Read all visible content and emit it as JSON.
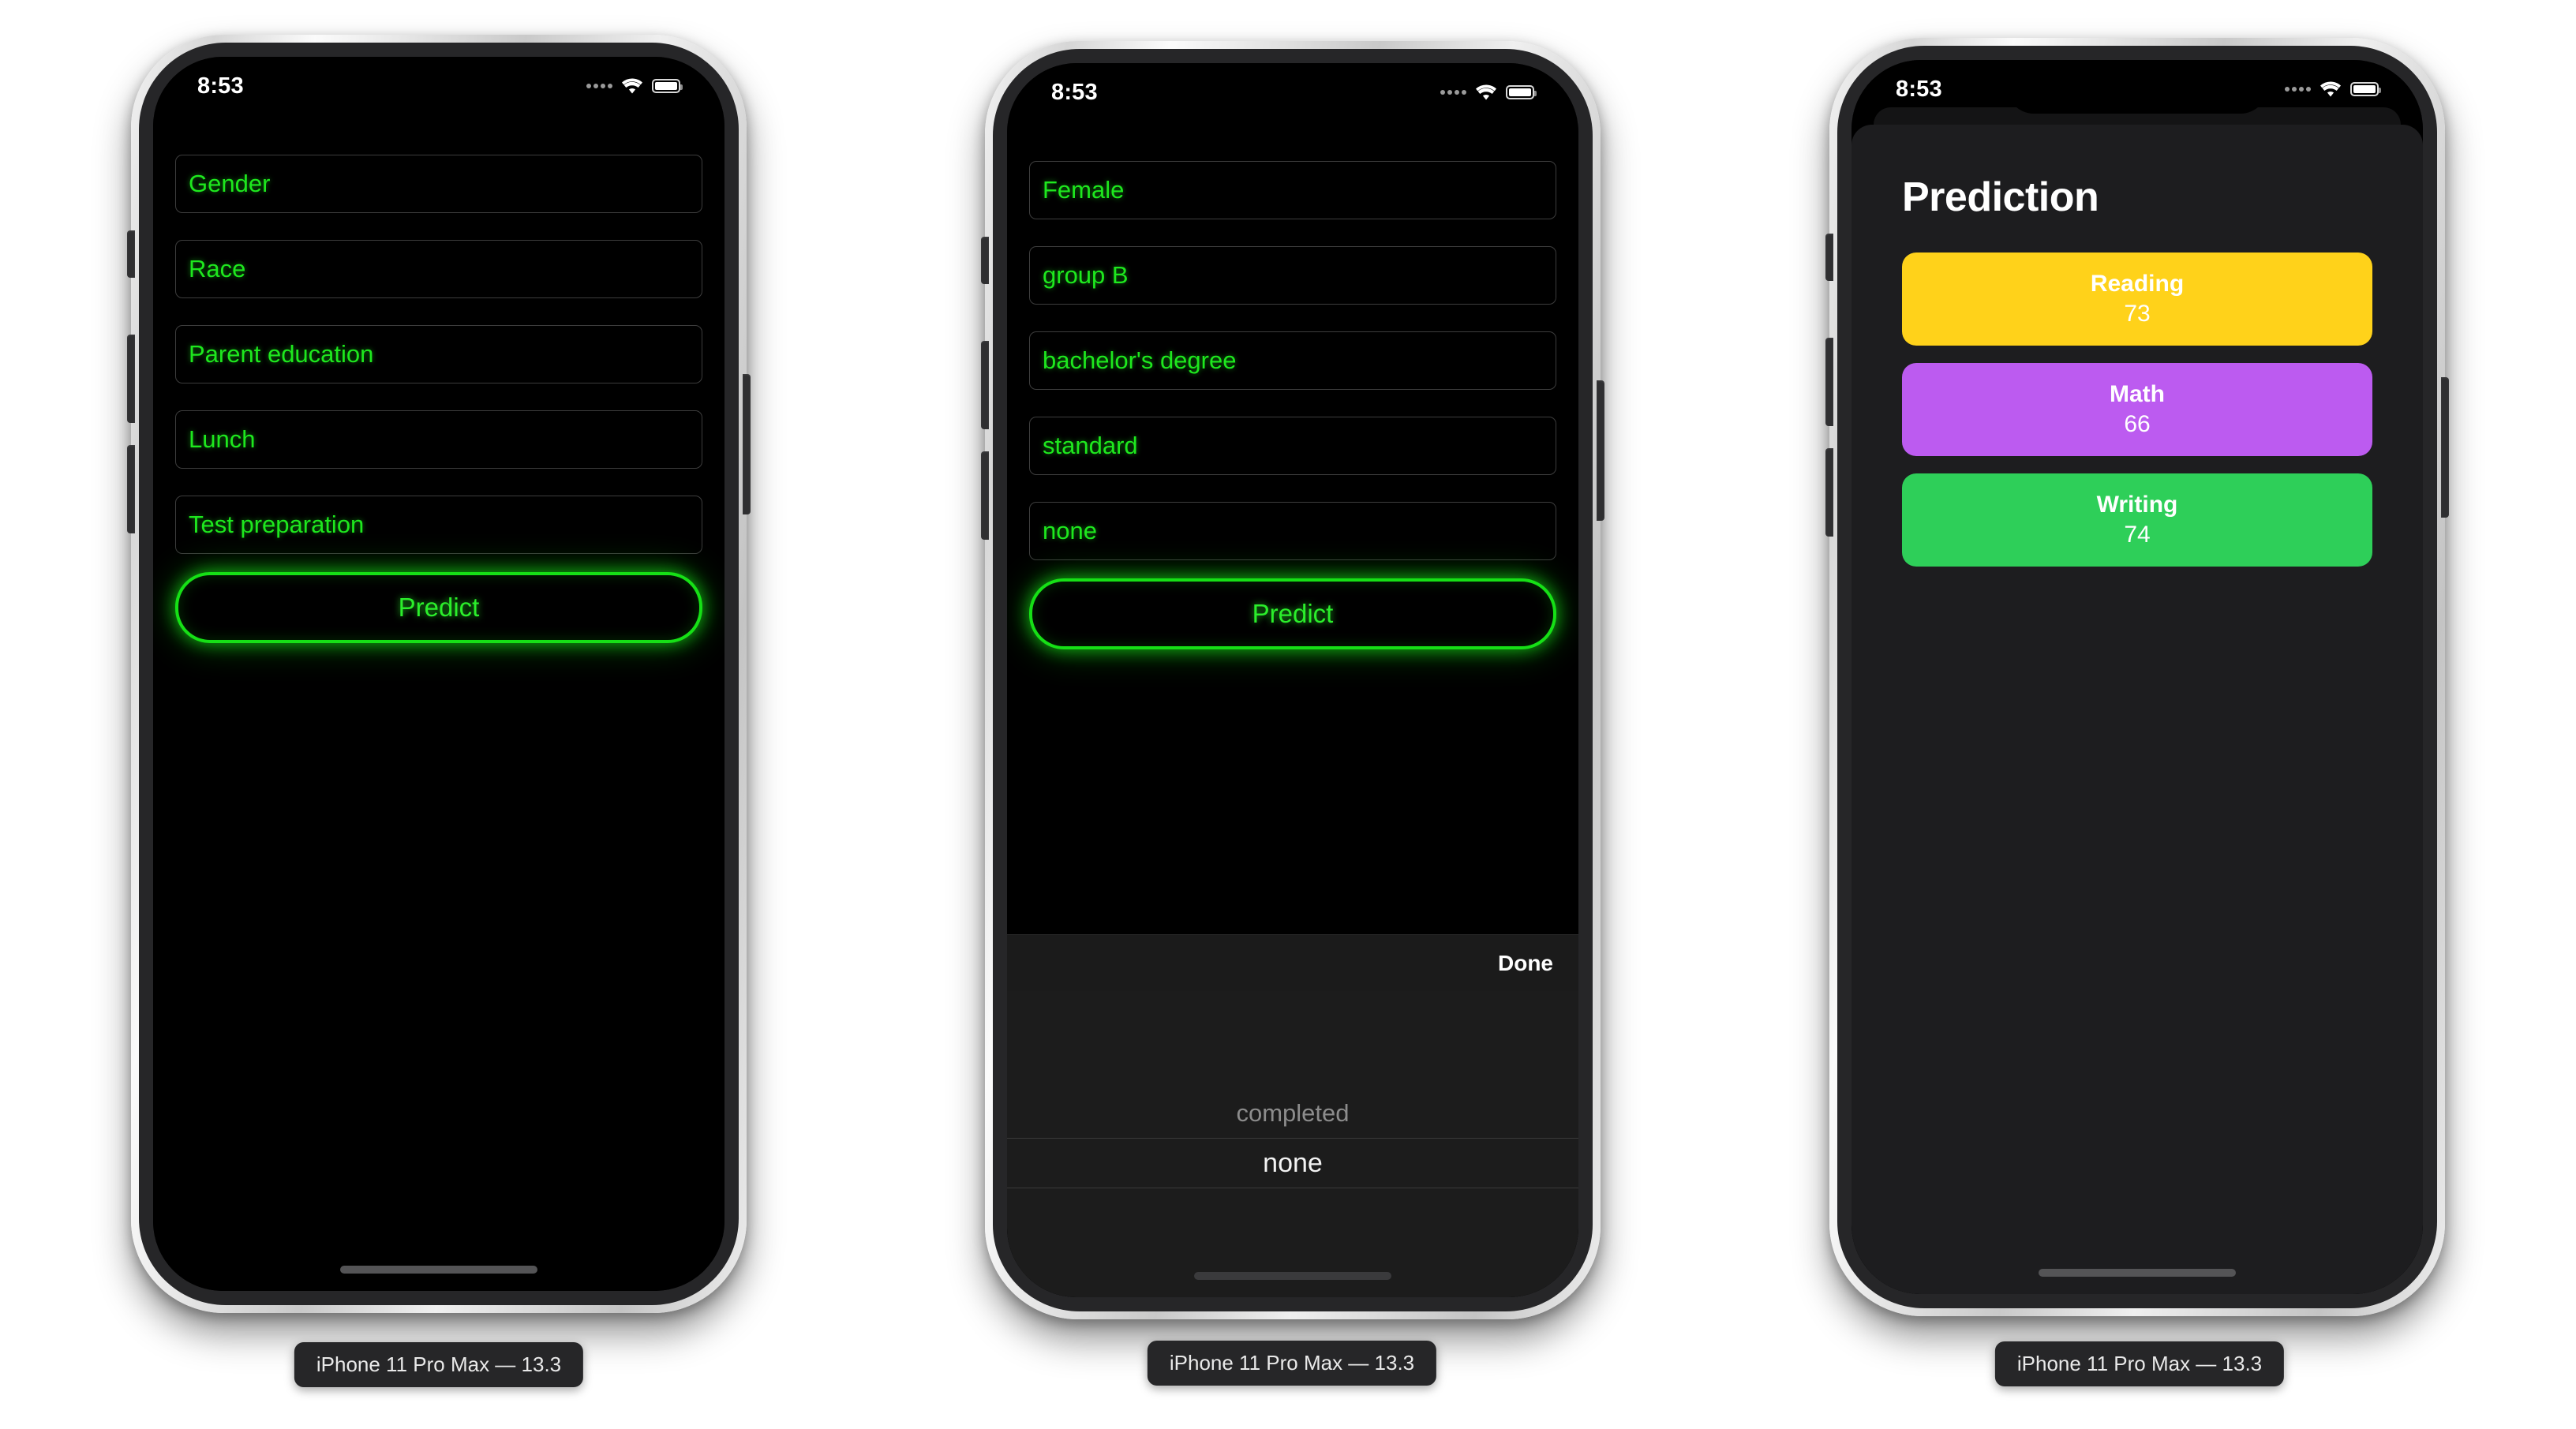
{
  "simulators": [
    {
      "caption": "iPhone 11 Pro Max — 13.3",
      "status": {
        "time": "8:53",
        "wifi": "wifi-icon",
        "battery": "battery-icon",
        "signal": "signal-dots-icon"
      },
      "screen": {
        "kind": "form-empty",
        "fields": [
          {
            "name": "gender",
            "value": "Gender"
          },
          {
            "name": "race",
            "value": "Race"
          },
          {
            "name": "parent_education",
            "value": "Parent education"
          },
          {
            "name": "lunch",
            "value": "Lunch"
          },
          {
            "name": "test_preparation",
            "value": "Test preparation"
          }
        ],
        "predict_label": "Predict"
      }
    },
    {
      "caption": "iPhone 11 Pro Max — 13.3",
      "status": {
        "time": "8:53",
        "wifi": "wifi-icon",
        "battery": "battery-icon",
        "signal": "signal-dots-icon"
      },
      "screen": {
        "kind": "form-filled",
        "fields": [
          {
            "name": "gender",
            "value": "Female"
          },
          {
            "name": "race",
            "value": "group B"
          },
          {
            "name": "parent_education",
            "value": "bachelor's degree"
          },
          {
            "name": "lunch",
            "value": "standard"
          },
          {
            "name": "test_preparation",
            "value": "none"
          }
        ],
        "predict_label": "Predict",
        "toolbar": {
          "done_label": "Done"
        },
        "picker": {
          "options": [
            {
              "label": "completed",
              "selected": false
            },
            {
              "label": "none",
              "selected": true
            }
          ]
        }
      }
    },
    {
      "caption": "iPhone 11 Pro Max — 13.3",
      "status": {
        "time": "8:53",
        "wifi": "wifi-icon",
        "battery": "battery-icon",
        "signal": "signal-dots-icon"
      },
      "screen": {
        "kind": "prediction",
        "title": "Prediction",
        "scores": [
          {
            "subject": "Reading",
            "value": "73",
            "color": "#FFD21A"
          },
          {
            "subject": "Math",
            "value": "66",
            "color": "#BC5BF0"
          },
          {
            "subject": "Writing",
            "value": "74",
            "color": "#2ECF59"
          }
        ]
      }
    }
  ]
}
